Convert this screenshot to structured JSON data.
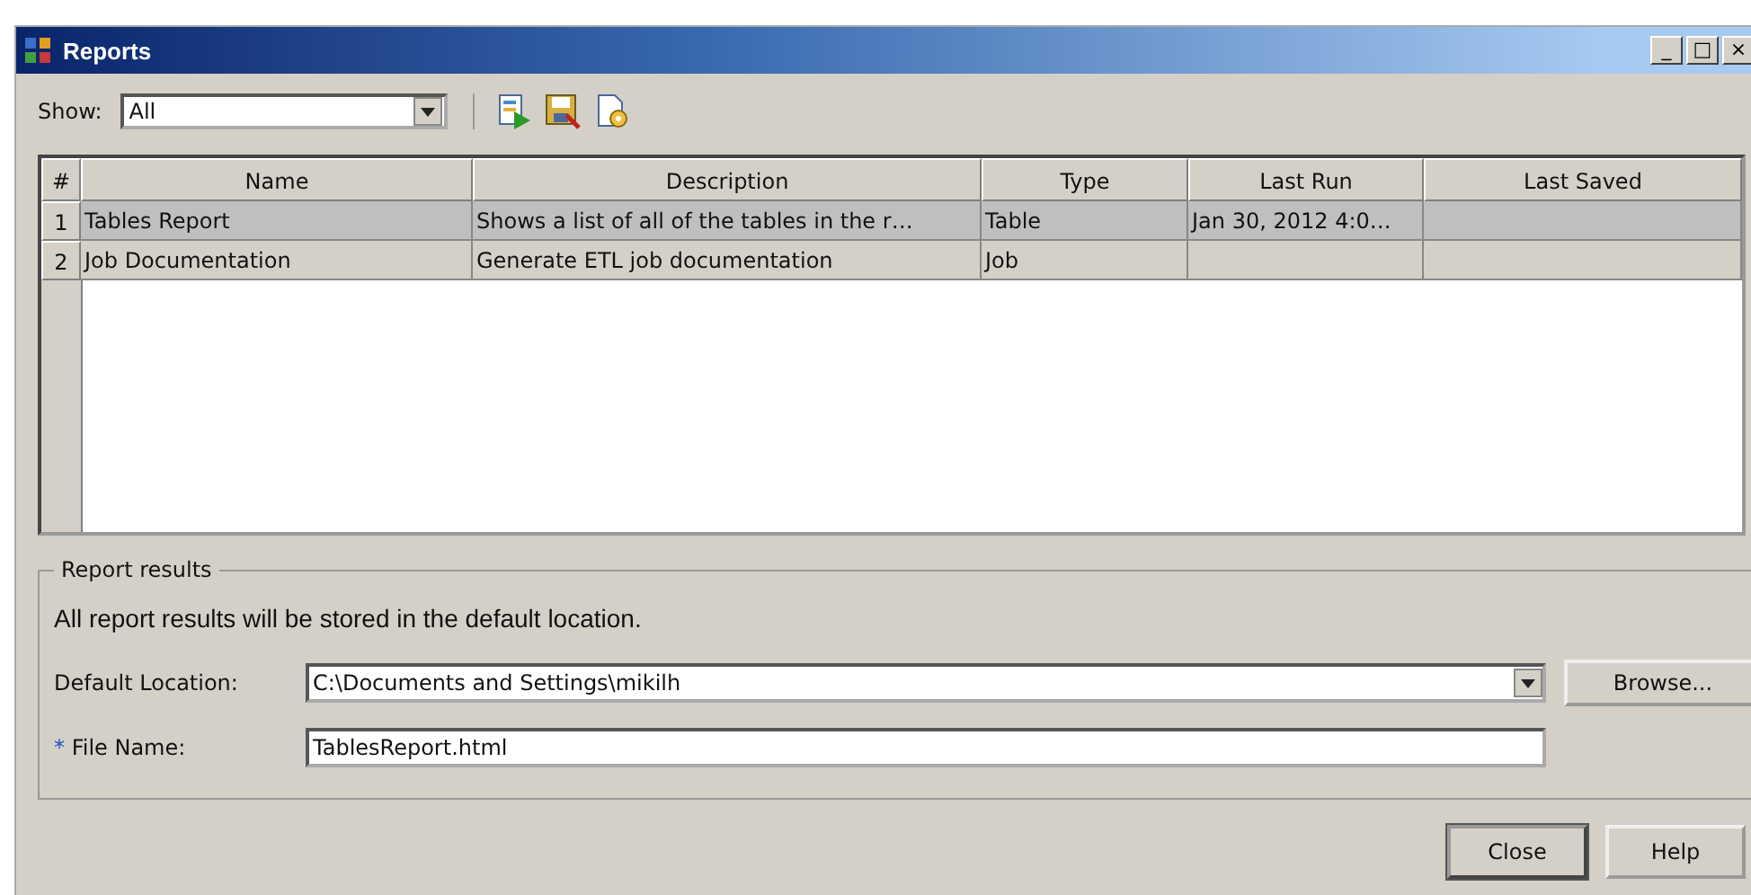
{
  "window": {
    "title": "Reports",
    "controls": [
      "_",
      "□",
      "×"
    ]
  },
  "toolbar": {
    "show_label": "Show:",
    "show_value": "All"
  },
  "table": {
    "columns": [
      "#",
      "Name",
      "Description",
      "Type",
      "Last Run",
      "Last Saved"
    ],
    "rows": [
      {
        "cells": [
          "1",
          "Tables Report",
          "Shows a list of all of the tables in the r…",
          "Table",
          "Jan 30, 2012 4:0…",
          ""
        ],
        "selected": true
      },
      {
        "cells": [
          "2",
          "Job Documentation",
          "Generate ETL job documentation",
          "Job",
          "",
          ""
        ],
        "selected": false
      }
    ]
  },
  "report_results": {
    "legend": "Report results",
    "note": "All report results will be stored in the default location.",
    "location_label": "Default Location:",
    "location_value": "C:\\Documents and Settings\\mikilh",
    "browse": "Browse...",
    "required_mark": "*",
    "file_label": "File Name:",
    "file_value": "TablesReport.html"
  },
  "buttons": [
    "Close",
    "Help"
  ]
}
